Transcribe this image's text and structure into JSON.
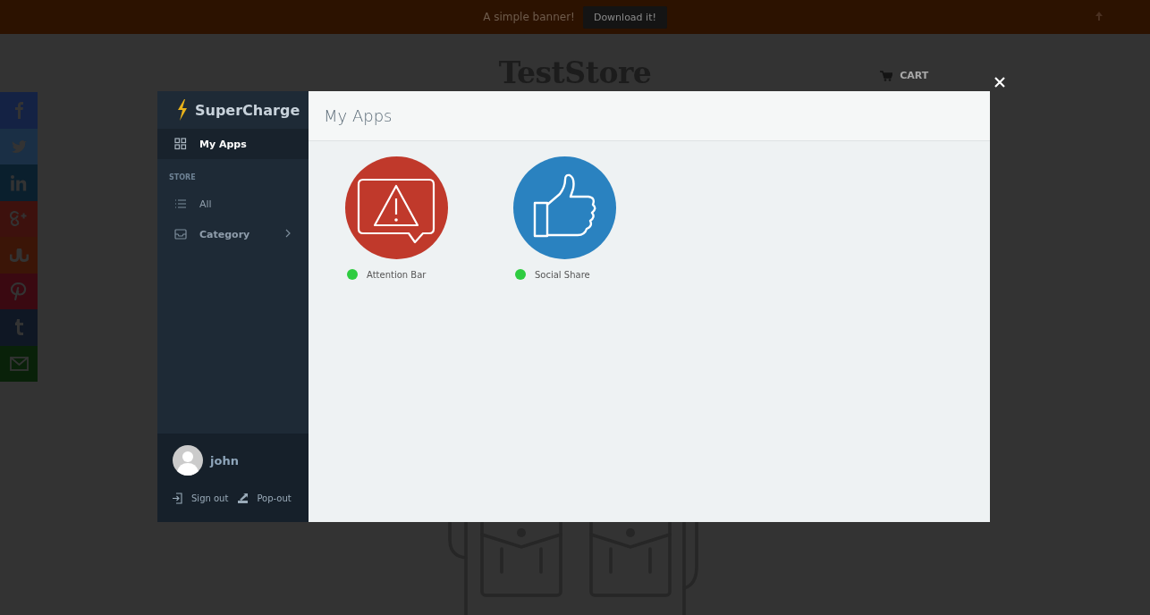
{
  "banner": {
    "text": "A simple banner!",
    "button": "Download it!"
  },
  "store": {
    "title": "TestStore",
    "cart": "CART"
  },
  "social_bar": [
    {
      "kind": "facebook",
      "color": "#142244"
    },
    {
      "kind": "twitter",
      "color": "#1a2f45"
    },
    {
      "kind": "linkedin",
      "color": "#0a1f2d"
    },
    {
      "kind": "googleplus",
      "color": "#3d110d"
    },
    {
      "kind": "stumbleupon",
      "color": "#3b1507"
    },
    {
      "kind": "pinterest",
      "color": "#3a0911"
    },
    {
      "kind": "tumblr",
      "color": "#0f1724"
    },
    {
      "kind": "email",
      "color": "#092109"
    }
  ],
  "sidebar": {
    "brand": "SuperCharge",
    "items": [
      {
        "label": "My Apps",
        "kind": "grid",
        "selected": true
      },
      {
        "label": "STORE",
        "kind": "section"
      },
      {
        "label": "All",
        "kind": "list",
        "selected": false
      },
      {
        "label": "Category",
        "kind": "inbox",
        "selected": false
      }
    ],
    "user": "john",
    "footer_links": [
      {
        "label": "Sign out",
        "kind": "signout"
      },
      {
        "label": "Pop-out",
        "kind": "popout"
      }
    ]
  },
  "content": {
    "title": "My Apps",
    "apps": [
      {
        "name": "Attention Bar",
        "kind": "alert",
        "color": "#c0392b",
        "enabled": true
      },
      {
        "name": "Social Share",
        "kind": "thumb",
        "color": "#2a82c0",
        "enabled": true
      }
    ]
  }
}
